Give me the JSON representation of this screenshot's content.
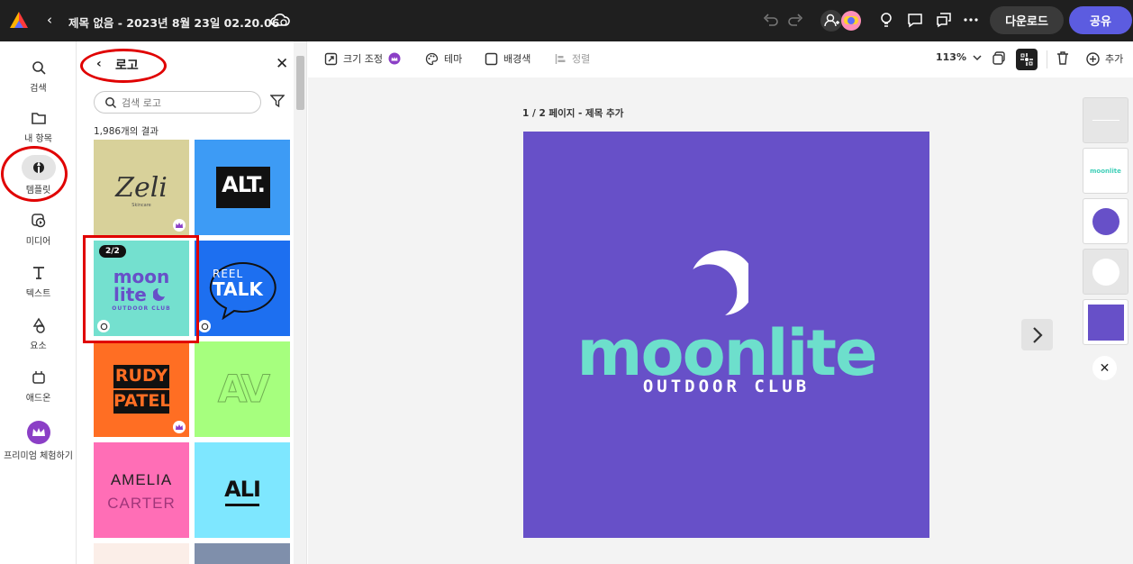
{
  "topbar": {
    "document_title": "제목 없음 - 2023년 8월 23일 02.20.06",
    "download_label": "다운로드",
    "share_label": "공유"
  },
  "leftrail": {
    "items": [
      {
        "label": "검색",
        "icon": "search-icon"
      },
      {
        "label": "내 항목",
        "icon": "folder-icon"
      },
      {
        "label": "템플릿",
        "icon": "templates-icon",
        "active": true
      },
      {
        "label": "미디어",
        "icon": "media-icon"
      },
      {
        "label": "텍스트",
        "icon": "text-icon"
      },
      {
        "label": "요소",
        "icon": "shapes-icon"
      },
      {
        "label": "애드온",
        "icon": "addons-icon"
      },
      {
        "label": "프리미엄 체험하기",
        "icon": "crown-icon"
      }
    ]
  },
  "panel": {
    "title": "로고",
    "search_placeholder": "검색 로고",
    "result_count": "1,986개의 결과",
    "selected_badge": "2/2",
    "cards": [
      {
        "name": "zeli",
        "text": "Zeli",
        "sub": "Skincare",
        "bg": "#d8d19a",
        "premium": true
      },
      {
        "name": "alt",
        "text": "ALT.",
        "bg": "#3d9bf5",
        "premium": false
      },
      {
        "name": "moonlite",
        "text": "moon",
        "text2": "lite",
        "sub": "OUTDOOR CLUB",
        "bg": "#74e0cf",
        "premium": false
      },
      {
        "name": "reel-talk",
        "text": "REEL",
        "text2": "TALK",
        "bg": "#1d6ff0",
        "premium": false
      },
      {
        "name": "rudy-patel",
        "text": "RUDY",
        "text2": "PATEL",
        "bg": "#ff6e23",
        "premium": true
      },
      {
        "name": "av",
        "text": "AV",
        "bg": "#a6ff7e",
        "premium": false
      },
      {
        "name": "amelia-carter",
        "text": "AMELIA",
        "text2": "CARTER",
        "bg": "#ff6eb6",
        "premium": false
      },
      {
        "name": "ali",
        "text": "ALI",
        "bg": "#7ee7ff",
        "premium": false
      }
    ]
  },
  "toolbar": {
    "resize_label": "크기 조정",
    "theme_label": "테마",
    "bgcolor_label": "배경색",
    "align_label": "정렬",
    "zoom": "113%",
    "add_label": "추가"
  },
  "canvas": {
    "page_label": "1 / 2 페이지 - 제목 추가",
    "art_title": "moonlite",
    "art_sub": "OUTDOOR CLUB",
    "art_bg": "#6750c8",
    "art_accent": "#6ddfcc"
  },
  "layers": {
    "thumb_text": "moonlite"
  }
}
